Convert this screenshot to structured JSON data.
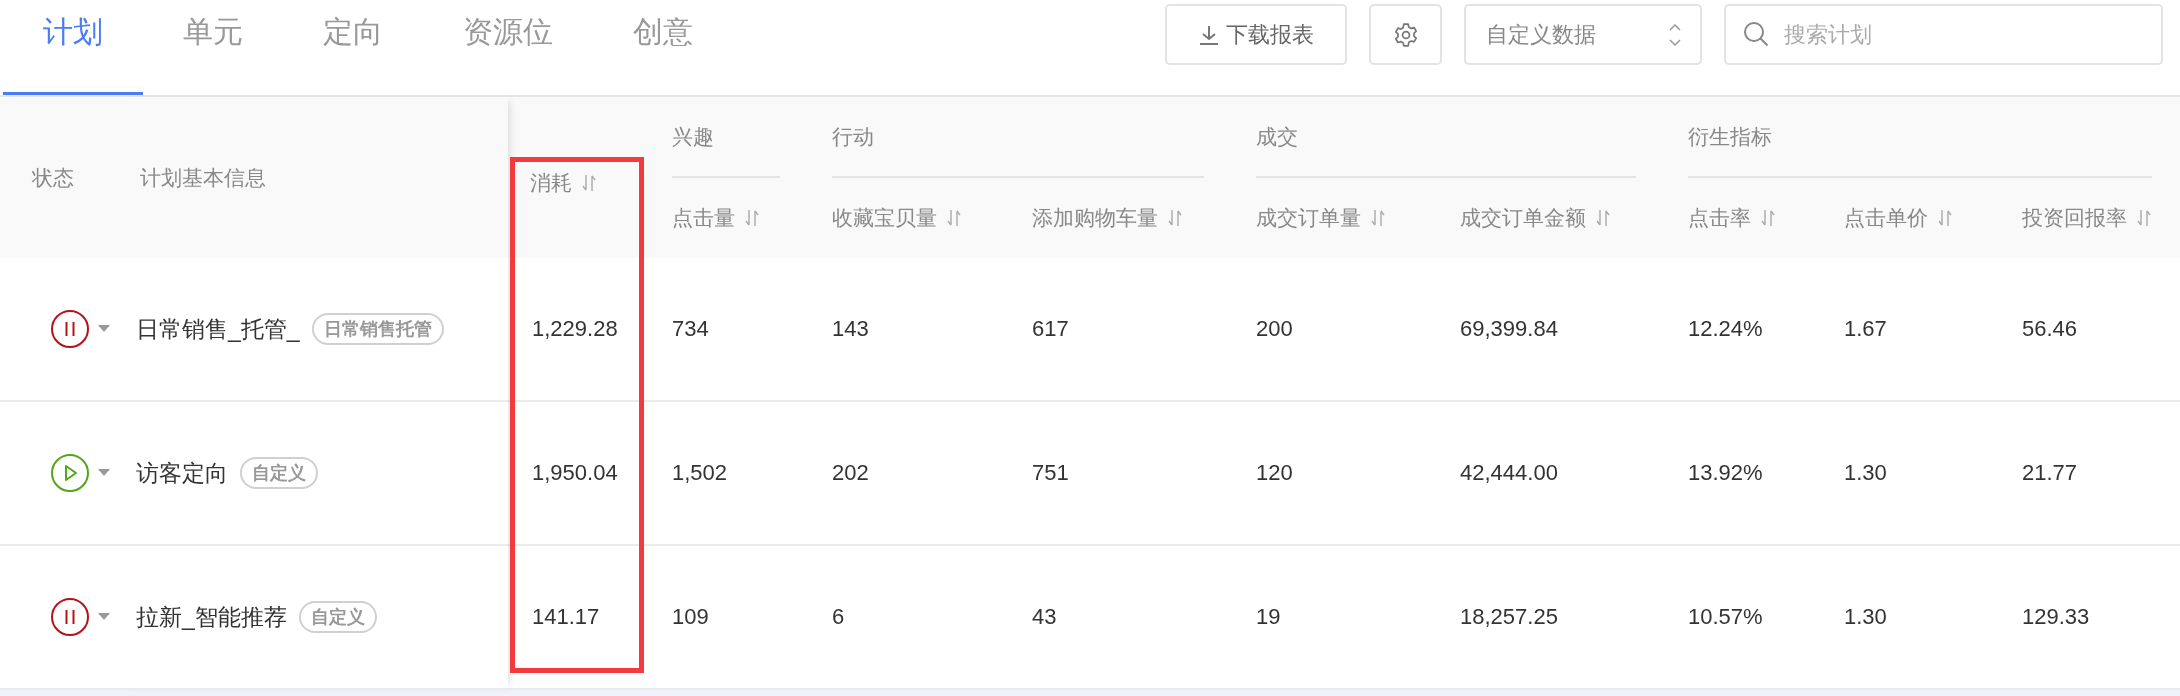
{
  "tabs": [
    {
      "label": "计划",
      "selected": true
    },
    {
      "label": "单元",
      "selected": false
    },
    {
      "label": "定向",
      "selected": false
    },
    {
      "label": "资源位",
      "selected": false
    },
    {
      "label": "创意",
      "selected": false
    }
  ],
  "toolbar": {
    "download_button": "下载报表",
    "data_select": {
      "value": "自定义数据"
    },
    "search": {
      "placeholder": "搜索计划"
    }
  },
  "table": {
    "fixed_columns": [
      "状态",
      "计划基本信息"
    ],
    "spend_column": {
      "label": "消耗",
      "highlighted": true
    },
    "groups": [
      {
        "label": "兴趣",
        "columns": [
          "点击量"
        ]
      },
      {
        "label": "行动",
        "columns": [
          "收藏宝贝量",
          "添加购物车量"
        ]
      },
      {
        "label": "成交",
        "columns": [
          "成交订单量",
          "成交订单金额"
        ]
      },
      {
        "label": "衍生指标",
        "columns": [
          "点击率",
          "点击单价",
          "投资回报率"
        ]
      }
    ],
    "rows": [
      {
        "running": false,
        "name": "日常销售_托管_",
        "tag": "日常销售托管",
        "values": [
          "1,229.28",
          "734",
          "143",
          "617",
          "200",
          "69,399.84",
          "12.24%",
          "1.67",
          "56.46"
        ]
      },
      {
        "running": true,
        "name": "访客定向",
        "tag": "自定义",
        "values": [
          "1,950.04",
          "1,502",
          "202",
          "751",
          "120",
          "42,444.00",
          "13.92%",
          "1.30",
          "21.77"
        ]
      },
      {
        "running": false,
        "name": "拉新_智能推荐",
        "tag": "自定义",
        "values": [
          "141.17",
          "109",
          "6",
          "43",
          "19",
          "18,257.25",
          "10.57%",
          "1.30",
          "129.33"
        ]
      }
    ]
  }
}
